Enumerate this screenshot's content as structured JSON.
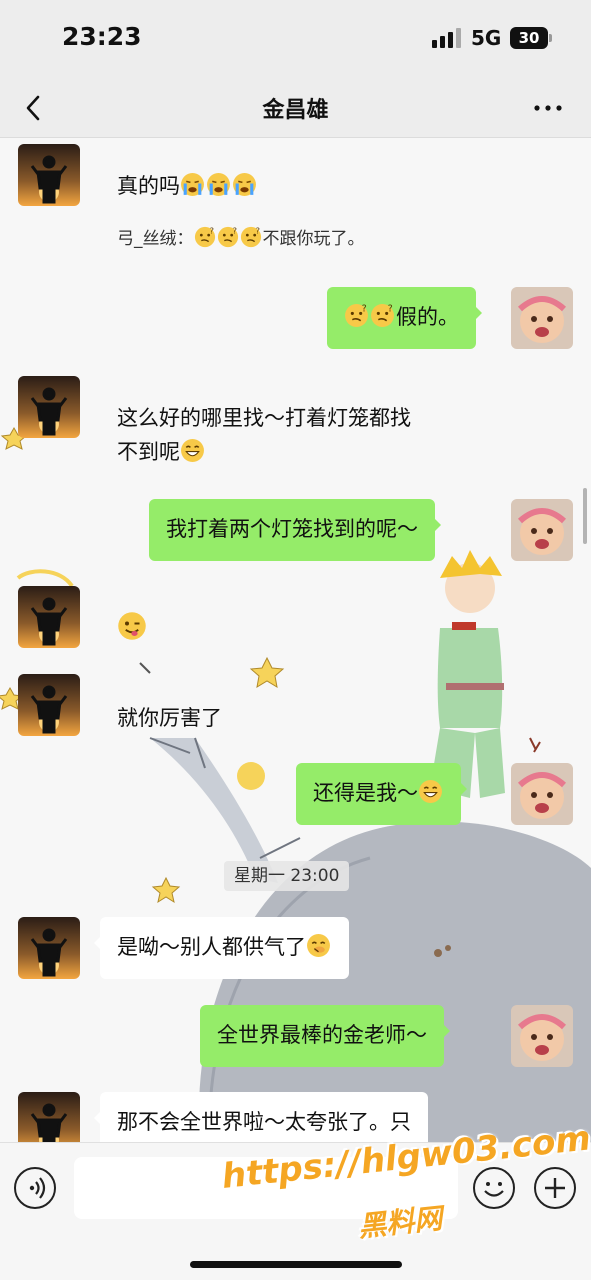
{
  "status_bar": {
    "time": "23:23",
    "network": "5G",
    "battery": "30"
  },
  "nav": {
    "title": "金昌雄"
  },
  "messages": [
    {
      "side": "in",
      "text": "真的吗",
      "emojis": [
        "crying-face-emoji",
        "crying-face-emoji",
        "crying-face-emoji"
      ]
    },
    {
      "type": "quote",
      "text": "弓_丝绒：",
      "suffix": "不跟你玩了。",
      "emojis": [
        "thinking-face-emoji",
        "thinking-face-emoji",
        "thinking-face-emoji"
      ]
    },
    {
      "side": "out",
      "text": "假的。",
      "emojis": [
        "thinking-face-emoji",
        "thinking-face-emoji"
      ]
    },
    {
      "side": "in",
      "line1": "这么好的哪里找～打着灯笼都找",
      "line2": "不到呢",
      "emojis": [
        "grinning-face-emoji"
      ]
    },
    {
      "side": "out",
      "text": "我打着两个灯笼找到的呢～"
    },
    {
      "side": "in",
      "emojis": [
        "winking-tongue-face-emoji"
      ]
    },
    {
      "side": "in",
      "text": "就你厉害了"
    },
    {
      "side": "out",
      "text": "还得是我～",
      "emojis": [
        "grinning-face-emoji"
      ]
    },
    {
      "side": "in",
      "text": "是呦～别人都供气了",
      "emojis": [
        "giggle-face-emoji"
      ]
    },
    {
      "side": "out",
      "text": "全世界最棒的金老师～"
    },
    {
      "side": "in",
      "text": "那不会全世界啦～太夸张了。只"
    }
  ],
  "timestamp": "星期一 23:00",
  "watermark": {
    "url": "https://hlgw03.com",
    "site": "黑料网"
  },
  "colors": {
    "outgoing_bubble": "#95ec69",
    "incoming_bubble": "#ffffff",
    "bar_bg": "#ededed"
  }
}
